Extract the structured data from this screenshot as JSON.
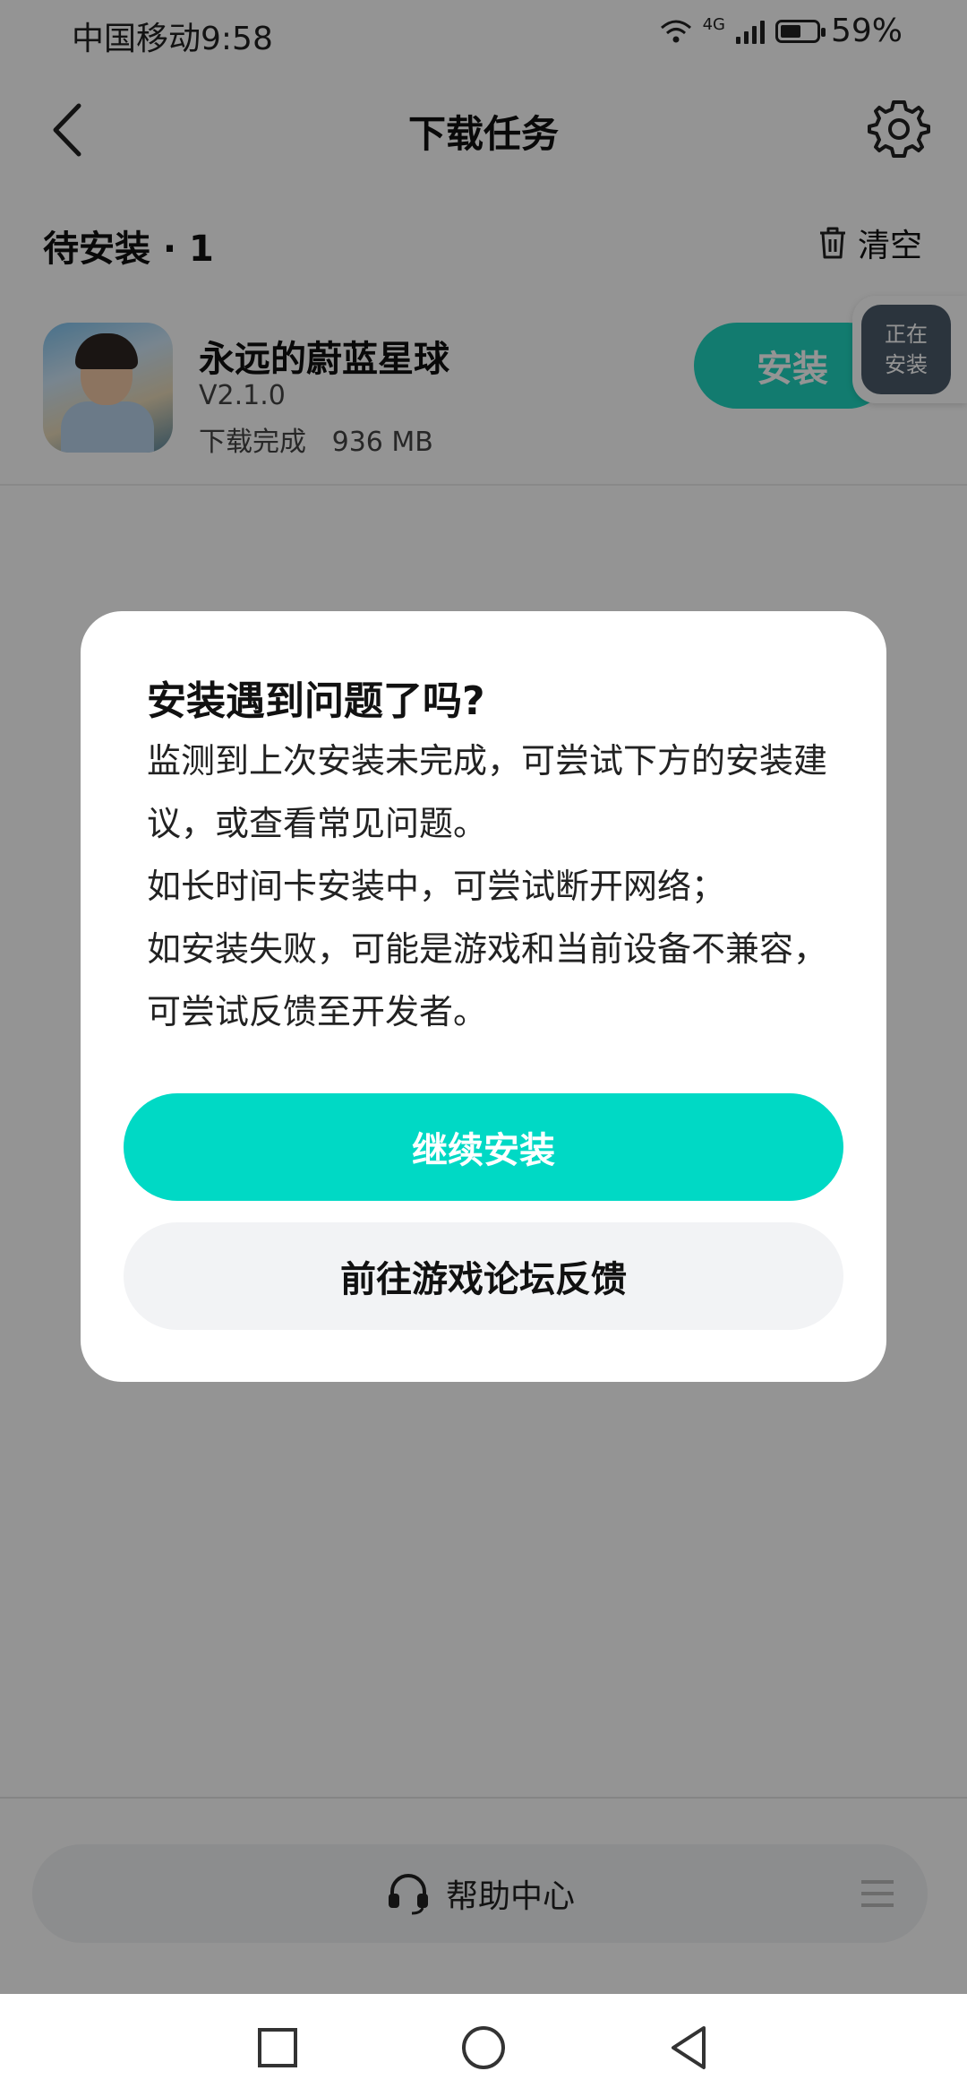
{
  "status_bar": {
    "carrier_time": "中国移动9:58",
    "network": "4G",
    "battery_percent": "59%",
    "battery_level": 0.59
  },
  "header": {
    "title": "下载任务",
    "back_icon": "chevron-left-icon",
    "settings_icon": "gear-icon"
  },
  "section": {
    "title": "待安装 · 1",
    "clear_label": "清空",
    "clear_icon": "trash-icon"
  },
  "app": {
    "name": "永远的蔚蓝星球",
    "version": "V2.1.0",
    "status": "下载完成   936 MB",
    "install_label": "安装"
  },
  "floating_badge": {
    "line1": "正在",
    "line2": "安装"
  },
  "dialog": {
    "title": "安装遇到问题了吗?",
    "paragraphs": [
      "监测到上次安装未完成，可尝试下方的安装建议，或查看常见问题。",
      "如长时间卡安装中，可尝试断开网络；",
      "如安装失败，可能是游戏和当前设备不兼容，可尝试反馈至开发者。"
    ],
    "primary_button": "继续安装",
    "secondary_button": "前往游戏论坛反馈"
  },
  "help_bar": {
    "label": "帮助中心",
    "icon": "headset-icon",
    "menu_icon": "menu-icon"
  },
  "colors": {
    "accent": "#00d9c5",
    "install_button": "#1fd5bf"
  }
}
